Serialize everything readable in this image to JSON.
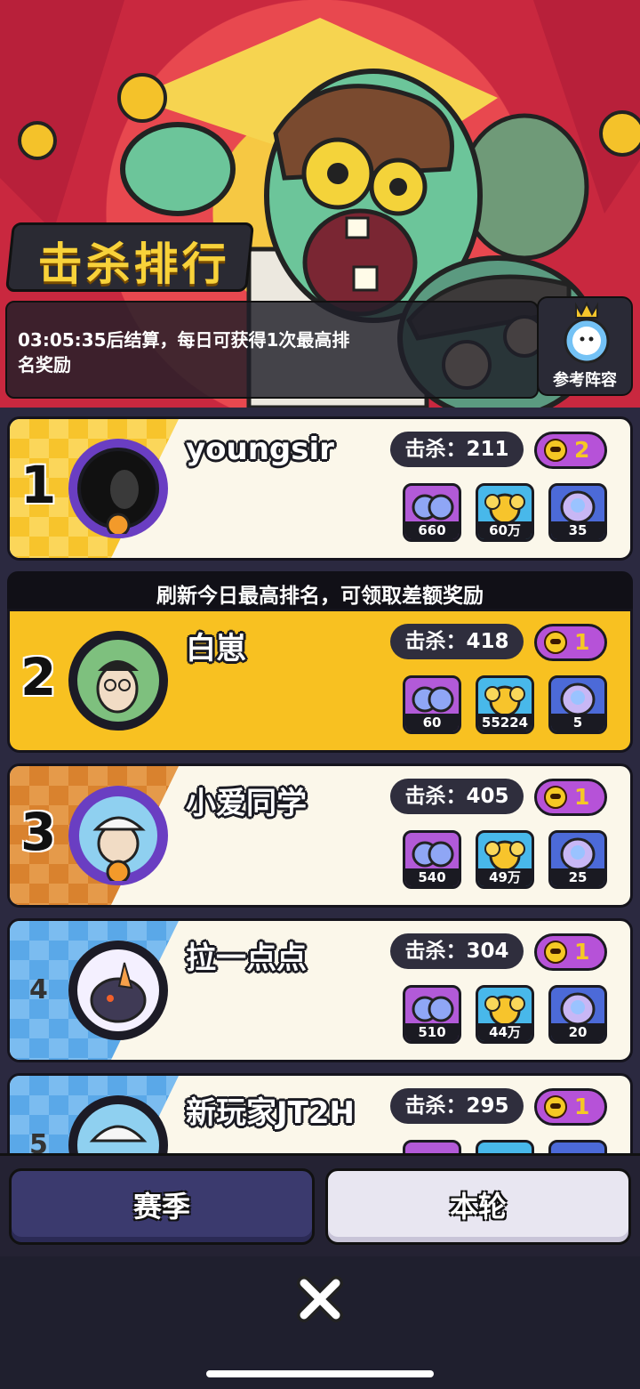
{
  "header": {
    "title": "击杀排行",
    "info": "03:05:35后结算，每日可获得1次最高排名奖励",
    "lineup_label": "参考阵容"
  },
  "notice": "刷新今日最高排名，可领取差额奖励",
  "rankings": [
    {
      "rank": "1",
      "name": "youngsir",
      "kills": "击杀：211",
      "badge": "2",
      "rewards": [
        "660",
        "60万",
        "35"
      ]
    },
    {
      "rank": "2",
      "name": "白崽",
      "kills": "击杀：418",
      "badge": "1",
      "rewards": [
        "60",
        "55224",
        "5"
      ]
    },
    {
      "rank": "3",
      "name": "小爱同学",
      "kills": "击杀：405",
      "badge": "1",
      "rewards": [
        "540",
        "49万",
        "25"
      ]
    },
    {
      "rank": "4",
      "name": "拉一点点",
      "kills": "击杀：304",
      "badge": "1",
      "rewards": [
        "510",
        "44万",
        "20"
      ]
    },
    {
      "rank": "5",
      "name": "新玩家JT2H",
      "kills": "击杀：295",
      "badge": "1",
      "rewards": []
    }
  ],
  "tabs": {
    "season": "赛季",
    "round": "本轮"
  },
  "colors": {
    "gold": "#f7c42c",
    "bronze": "#d9822e",
    "blue": "#5aa8e8",
    "purple_badge": "#b652d8",
    "highlight": "#f8c121"
  }
}
